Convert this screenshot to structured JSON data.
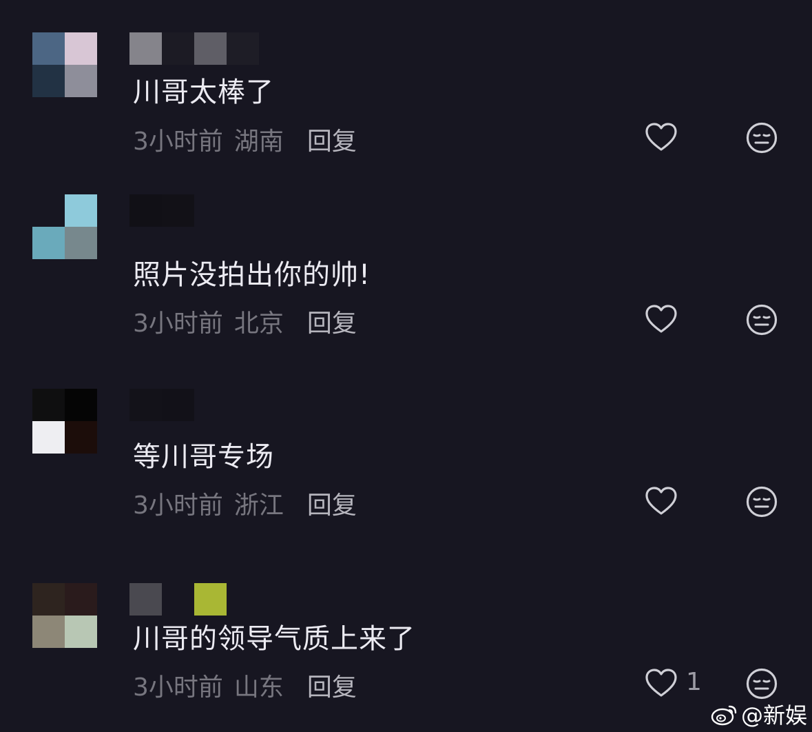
{
  "comments": [
    {
      "text": "川哥太棒了",
      "time": "3小时前",
      "location": "湖南",
      "reply_label": "回复",
      "like_count": "",
      "avatar_colors": [
        "#4c6684",
        "#d8c6d5",
        "#223244",
        "#8e8e9a"
      ],
      "username_colors": [
        "#85848b",
        "#1c1b24",
        "#5f5e66",
        "#1e1d26"
      ]
    },
    {
      "text": "照片没拍出你的帅!",
      "time": "3小时前",
      "location": "北京",
      "reply_label": "回复",
      "like_count": "",
      "avatar_colors": [
        "#171621",
        "#8ecadb",
        "#6aaabb",
        "#77888d"
      ],
      "username_colors": [
        "#111016",
        "#121117",
        "#171621",
        "#171621"
      ]
    },
    {
      "text": "等川哥专场",
      "time": "3小时前",
      "location": "浙江",
      "reply_label": "回复",
      "like_count": "",
      "avatar_colors": [
        "#0f0f10",
        "#050505",
        "#eeeef2",
        "#1c0d0a"
      ],
      "username_colors": [
        "#131219",
        "#121118",
        "#171621",
        "#171621"
      ]
    },
    {
      "text": "川哥的领导气质上来了",
      "time": "3小时前",
      "location": "山东",
      "reply_label": "回复",
      "like_count": "1",
      "avatar_colors": [
        "#2e241f",
        "#2a1b1c",
        "#8d8777",
        "#b8c7b4"
      ],
      "username_colors": [
        "#4a4950",
        "#171621",
        "#a9b734",
        "#171621"
      ]
    }
  ],
  "watermark": {
    "text": "@新娱"
  },
  "colors": {
    "background": "#171621",
    "comment_text": "#ecebf2",
    "meta_text": "#77767f",
    "reply_text": "#b6b5bd",
    "icon_stroke": "#cfcfd6"
  },
  "icons": {
    "like": "heart-icon",
    "dislike": "meh-face-icon",
    "watermark": "weibo-logo-icon"
  }
}
